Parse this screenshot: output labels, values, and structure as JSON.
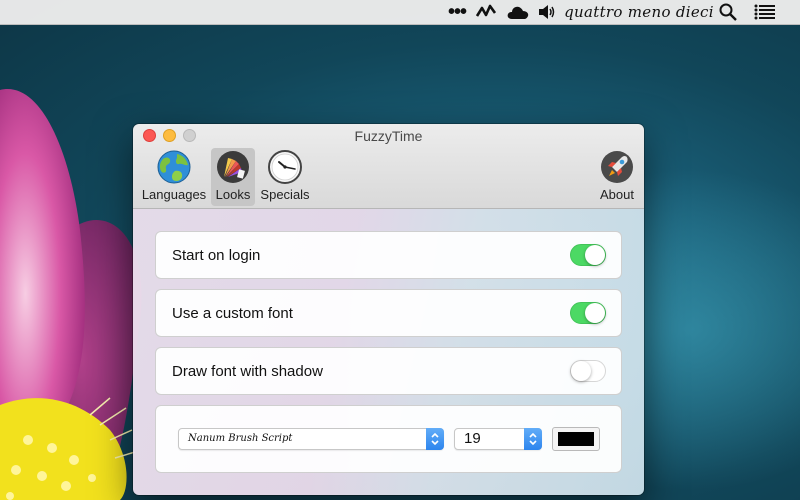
{
  "menubar": {
    "dots_icon": "more-dots-icon",
    "activity_icon": "activity-icon",
    "cloud_icon": "cloud-icon",
    "volume_icon": "volume-icon",
    "clock_text": "quattro meno dieci",
    "search_icon": "spotlight-search-icon",
    "list_icon": "notification-center-icon"
  },
  "window": {
    "title": "FuzzyTime",
    "toolbar": [
      {
        "label": "Languages",
        "icon": "globe-icon"
      },
      {
        "label": "Looks",
        "icon": "color-palette-icon",
        "selected": true
      },
      {
        "label": "Specials",
        "icon": "clock-icon"
      },
      {
        "label": "About",
        "icon": "rocket-icon"
      }
    ]
  },
  "settings": {
    "start_on_login": {
      "label": "Start on login",
      "enabled": true
    },
    "custom_font": {
      "label": "Use a custom font",
      "enabled": true
    },
    "font_shadow": {
      "label": "Draw font with shadow",
      "enabled": false
    },
    "font_name": "Nanum Brush Script",
    "font_size": "19",
    "font_color": "#000000"
  },
  "colors": {
    "toggle_on": "#4cd964",
    "popup_accent": "#2d85ee",
    "close": "#fc5753",
    "minimize": "#fdbc40"
  }
}
